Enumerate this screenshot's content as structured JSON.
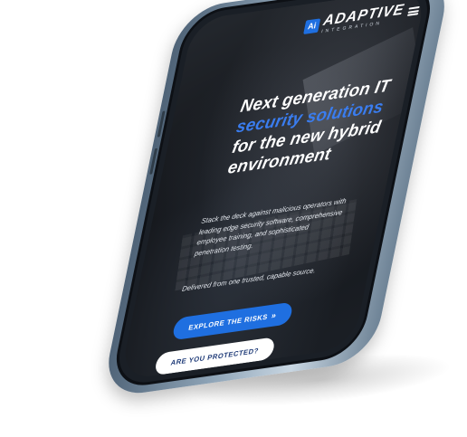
{
  "header": {
    "logo_mark": "Ai",
    "logo_name": "ADAPTIVE",
    "logo_subtitle": "INTEGRATION",
    "menu_icon": "hamburger-icon"
  },
  "hero": {
    "headline_part1": "Next generation IT ",
    "headline_highlight": "security solutions",
    "headline_part2": " for the new hybrid environment",
    "paragraph1": "Stack the deck against malicious operators with leading edge security software, comprehensive employee training, and sophisticated penetration testing.",
    "paragraph2": "Delivered from one trusted, capable source."
  },
  "buttons": {
    "explore_label": "EXPLORE THE RISKS",
    "explore_icon": "»",
    "protected_label": "ARE YOU PROTECTED?"
  },
  "colors": {
    "accent": "#1f6fe0",
    "headline_highlight": "#3a7df0",
    "phone_frame": "#8da3b6"
  }
}
